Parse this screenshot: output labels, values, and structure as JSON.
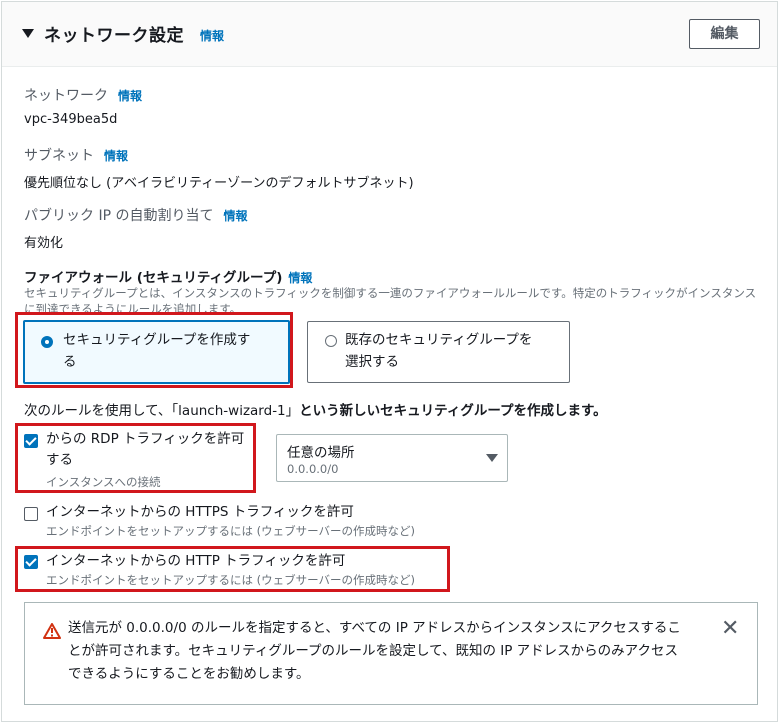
{
  "header": {
    "title": "ネットワーク設定",
    "info": "情報",
    "edit_label": "編集"
  },
  "fields": [
    {
      "label": "ネットワーク",
      "info": "情報",
      "value": "vpc-349bea5d"
    },
    {
      "label": "サブネット",
      "info": "情報",
      "value": "優先順位なし (アベイラビリティーゾーンのデフォルトサブネット)"
    },
    {
      "label": "パブリック IP の自動割り当て",
      "info": "情報",
      "value": "有効化"
    }
  ],
  "firewall": {
    "title": "ファイアウォール (セキュリティグループ)",
    "info": "情報",
    "description": "セキュリティグループとは、インスタンスのトラフィックを制御する一連のファイアウォールルールです。特定のトラフィックがインスタンスに到達できるようにルールを追加します。",
    "option_create_line1": "セキュリティグループを作成す",
    "option_create_line2": "る",
    "option_existing_line1": "既存のセキュリティグループを",
    "option_existing_line2": "選択する",
    "rule_prefix": "次のルールを使用して、「launch-wizard-1」",
    "rule_bold": "という新しいセキュリティグループを作成します。"
  },
  "rules": {
    "rdp": {
      "label_line1": "からの RDP トラフィックを許可",
      "label_line2": "する",
      "sub": "インスタンスへの接続",
      "checked": true
    },
    "rdp_source": {
      "label": "任意の場所",
      "sub": "0.0.0.0/0"
    },
    "https": {
      "label": "インターネットからの HTTPS トラフィックを許可",
      "sub": "エンドポイントをセットアップするには (ウェブサーバーの作成時など)",
      "checked": false
    },
    "http": {
      "label": "インターネットからの HTTP トラフィックを許可",
      "sub": "エンドポイントをセットアップするには (ウェブサーバーの作成時など)",
      "checked": true
    }
  },
  "alert": {
    "line1": "送信元が 0.0.0.0/0 のルールを指定すると、すべての IP アドレスからインスタンスにアクセスするこ",
    "line2": "とが許可されます。セキュリティグループのルールを設定して、既知の IP アドレスからのみアクセス",
    "line3": "できるようにすることをお勧めします。",
    "close": "✕"
  },
  "colors": {
    "accent": "#0073bb",
    "highlight": "#d1171c",
    "warning": "#d13212"
  }
}
